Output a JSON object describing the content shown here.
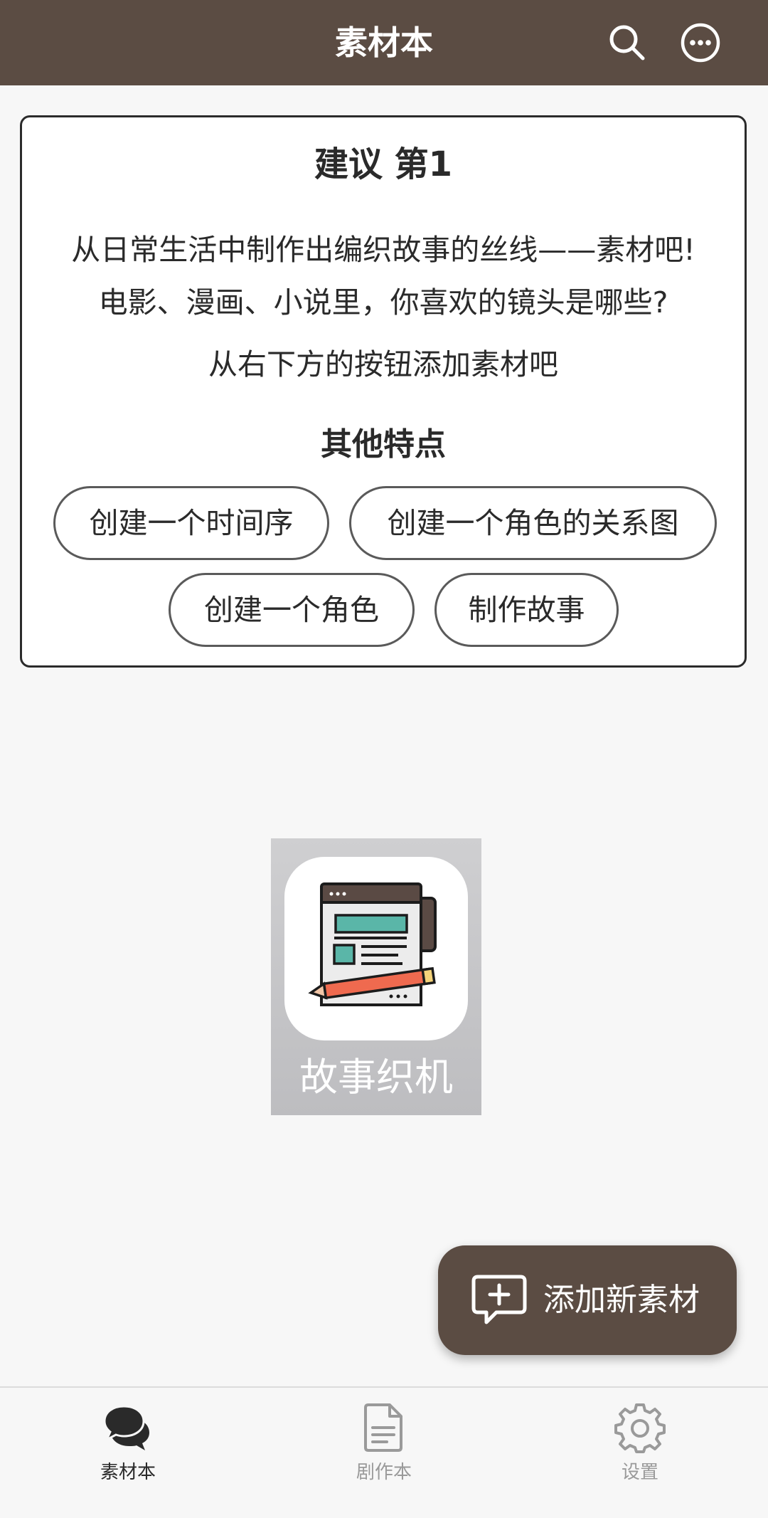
{
  "header": {
    "title": "素材本",
    "search_icon": "search-icon",
    "more_icon": "more-horizontal-circle-icon"
  },
  "tip_card": {
    "title": "建议 第1",
    "lines": [
      "从日常生活中制作出编织故事的丝线——素材吧!",
      "电影、漫画、小说里，你喜欢的镜头是哪些?",
      "从右下方的按钮添加素材吧"
    ],
    "features_title": "其他特点",
    "features": [
      "创建一个时间序",
      "创建一个角色的关系图",
      "创建一个角色",
      "制作故事"
    ]
  },
  "app_icon": {
    "label": "故事织机",
    "icon": "notebook-pencil-icon"
  },
  "fab": {
    "label": "添加新素材",
    "icon": "add-comment-icon"
  },
  "bottom_nav": {
    "items": [
      {
        "label": "素材本",
        "icon": "chat-bubbles-icon",
        "active": true
      },
      {
        "label": "剧作本",
        "icon": "document-icon",
        "active": false
      },
      {
        "label": "设置",
        "icon": "gear-icon",
        "active": false
      }
    ]
  },
  "colors": {
    "brand": "#5b4c43",
    "background": "#f7f7f7",
    "nav_active": "#2a2a2a",
    "nav_inactive": "#9a9a9a"
  }
}
